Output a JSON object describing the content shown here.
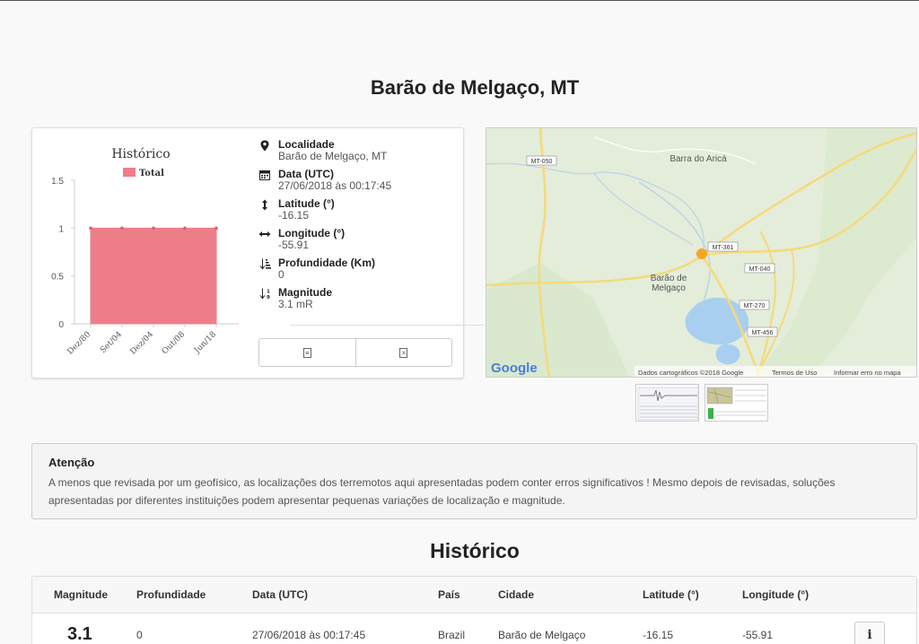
{
  "page": {
    "title": "Barão de Melgaço, MT"
  },
  "chart_data": {
    "type": "area",
    "title": "Histórico",
    "legend": [
      "Total"
    ],
    "legend_position": "top",
    "categories": [
      "Dez/80",
      "Set/04",
      "Dez/04",
      "Out/08",
      "Jun/18"
    ],
    "series": [
      {
        "name": "Total",
        "values": [
          1,
          1,
          1,
          1,
          1
        ]
      }
    ],
    "yticks": [
      "0",
      "0.5",
      "1",
      "1.5"
    ],
    "ylim": [
      0,
      1.5
    ],
    "grid": false,
    "colors": {
      "fill": "#ee7d8a",
      "point": "#e35d6e"
    }
  },
  "details": {
    "localidade": {
      "label": "Localidade",
      "value": "Barão de Melgaço, MT"
    },
    "data": {
      "label": "Data (UTC)",
      "value": "27/06/2018 às 00:17:45"
    },
    "latitude": {
      "label": "Latitude (°)",
      "value": "-16.15"
    },
    "longitude": {
      "label": "Longitude (°)",
      "value": "-55.91"
    },
    "profundidade": {
      "label": "Profundidade (Km)",
      "value": "0"
    },
    "magnitude": {
      "label": "Magnitude",
      "value": "3.1 mR"
    }
  },
  "icons": {
    "localidade": "map-marker-icon",
    "data": "calendar-icon",
    "latitude": "arrows-vertical-icon",
    "longitude": "arrows-horizontal-icon",
    "profundidade": "sort-amount-icon",
    "magnitude": "sort-numeric-icon",
    "export_pdf": "file-text-icon",
    "export_xls": "file-excel-icon",
    "info": "info-icon"
  },
  "map": {
    "places": {
      "barra": "Barra do Aricá",
      "barao_line1": "Barão de",
      "barao_line2": "Melgaço"
    },
    "roads": [
      "MT-050",
      "MT-361",
      "MT-040",
      "MT-270",
      "MT-456"
    ],
    "logo": "Google",
    "footer": {
      "data": "Dados cartográficos ©2018 Google",
      "terms": "Termos de Uso",
      "report": "Informar erro no mapa"
    },
    "colors": {
      "land": "#e6eedd",
      "water": "#a8cff0",
      "road": "#f6d97a",
      "marker": "#f5a623"
    }
  },
  "alert": {
    "title": "Atenção",
    "body": "A menos que revisada por um geofísico, as localizações dos terremotos aqui apresentadas podem conter erros significativos ! Mesmo depois de revisadas, soluções apresentadas por diferentes instituições podem apresentar pequenas variações de localização e magnitude."
  },
  "history": {
    "title": "Histórico",
    "headers": {
      "magnitude": "Magnitude",
      "profundidade": "Profundidade",
      "data": "Data (UTC)",
      "pais": "País",
      "cidade": "Cidade",
      "latitude": "Latitude (°)",
      "longitude": "Longitude (°)"
    },
    "rows": [
      {
        "magnitude": "3.1",
        "profundidade": "0",
        "data": "27/06/2018 às 00:17:45",
        "pais": "Brazil",
        "cidade": "Barão de Melgaço",
        "latitude": "-16.15",
        "longitude": "-55.91"
      }
    ]
  }
}
